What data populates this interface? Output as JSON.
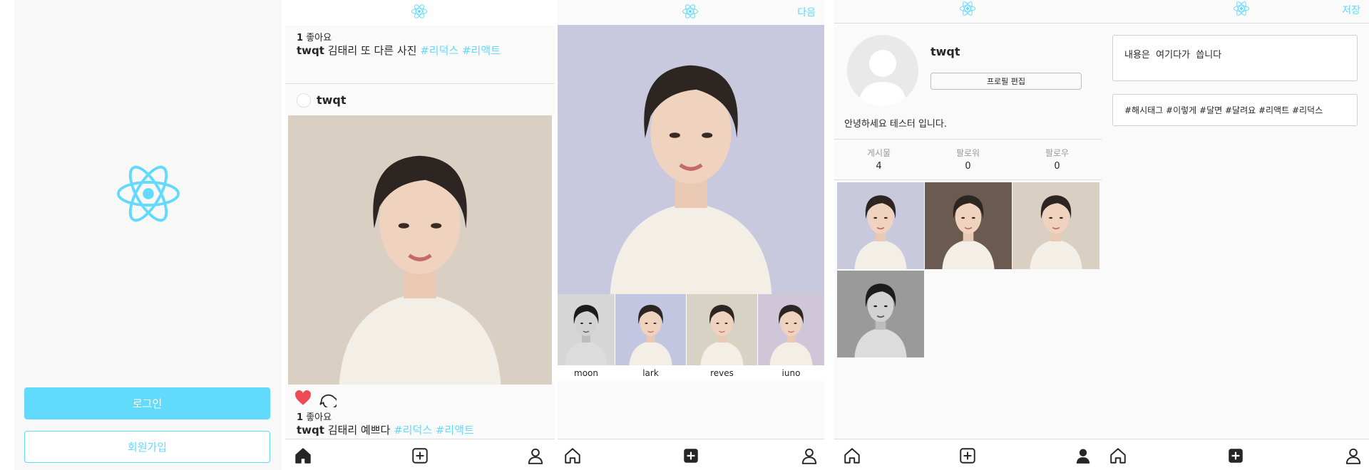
{
  "colors": {
    "accent": "#61dafb",
    "like": "#ed4956",
    "splash_bg": "#f8f8f8",
    "divider": "#dbdbdb"
  },
  "splash": {
    "logo_icon": "react-atom-icon",
    "login_label": "로그인",
    "signup_label": "회원가입"
  },
  "feed": {
    "top_post": {
      "likes": "1",
      "likes_label": "좋아요",
      "username": "twqt",
      "caption": "김태리 또 다른 사진",
      "tags": [
        "#리덕스",
        "#리액트"
      ]
    },
    "post": {
      "username": "twqt",
      "likes": "1",
      "likes_label": "좋아요",
      "caption": "김태리 예쁘다",
      "tags": [
        "#리덕스",
        "#리액트"
      ]
    }
  },
  "upload": {
    "next_label": "다음",
    "filters": [
      "moon",
      "lark",
      "reves",
      "iuno"
    ]
  },
  "profile": {
    "username": "twqt",
    "edit_label": "프로필 편집",
    "bio": "안녕하세요 테스터 입니다.",
    "stats": [
      {
        "label": "게시물",
        "value": "4"
      },
      {
        "label": "팔로워",
        "value": "0"
      },
      {
        "label": "팔로우",
        "value": "0"
      }
    ]
  },
  "write": {
    "save_label": "저장",
    "content_value": "내용은  여기다가  씁니다",
    "hashtags_value": "#해시태그 #이렇게 #달면 #달려요 #리액트 #리덕스"
  }
}
